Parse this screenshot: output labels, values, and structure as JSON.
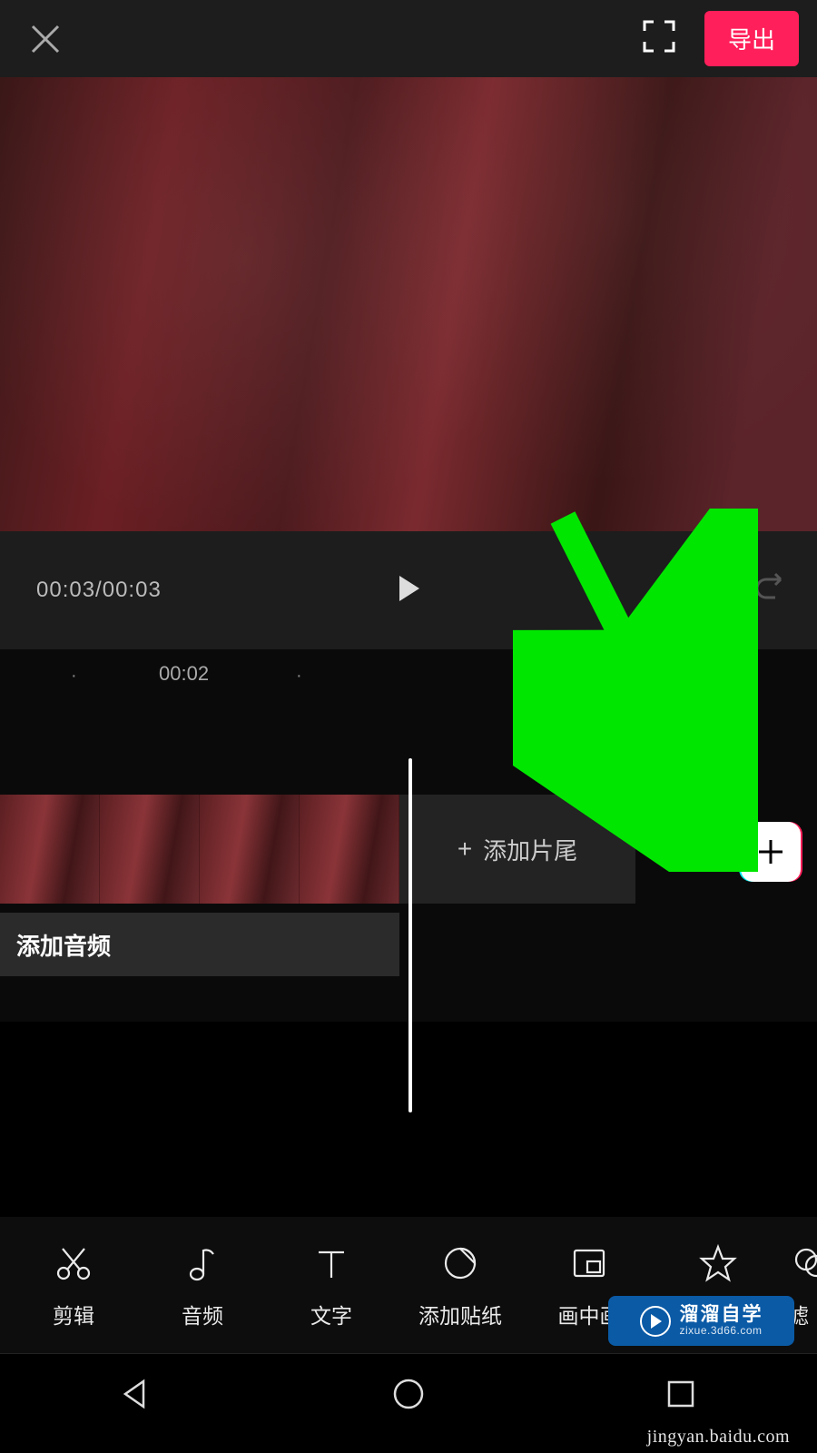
{
  "header": {
    "export_label": "导出"
  },
  "playback": {
    "time_display": "00:03/00:03"
  },
  "ruler": {
    "tick_label": "00:02"
  },
  "timeline": {
    "tail_label": "添加片尾",
    "audio_label": "添加音频"
  },
  "toolbar": {
    "items": [
      {
        "label": "剪辑"
      },
      {
        "label": "音频"
      },
      {
        "label": "文字"
      },
      {
        "label": "添加贴纸"
      },
      {
        "label": "画中画"
      },
      {
        "label": "特效"
      },
      {
        "label": "滤"
      }
    ]
  },
  "watermark": {
    "line1": "溜溜自学",
    "line2": "zixue.3d66.com",
    "source": "jingyan.baidu.com"
  },
  "annotation": {
    "arrow_color": "#00e600"
  }
}
